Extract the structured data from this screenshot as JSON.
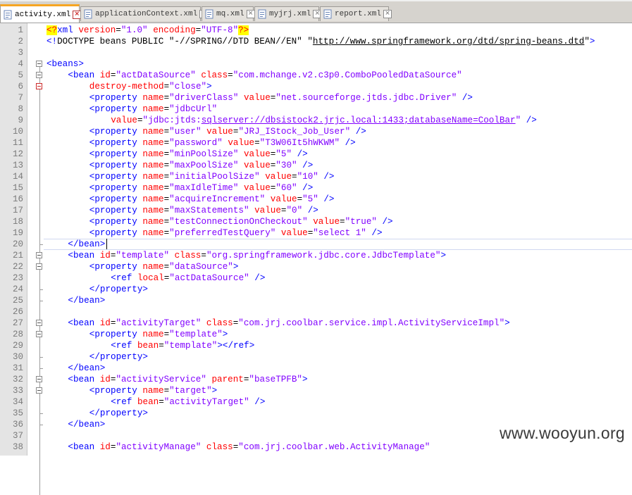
{
  "tabs": [
    {
      "label": "activity.xml",
      "active": true
    },
    {
      "label": "applicationContext.xml",
      "active": false
    },
    {
      "label": "mq.xml",
      "active": false
    },
    {
      "label": "myjrj.xml",
      "active": false
    },
    {
      "label": "report.xml",
      "active": false
    }
  ],
  "editor": {
    "current_line": 20,
    "lines": [
      {
        "n": "1",
        "indent": 0,
        "toks": [
          [
            "pi",
            "<?"
          ],
          [
            "tag",
            "xml "
          ],
          [
            "attr",
            "version"
          ],
          [
            "op",
            "="
          ],
          [
            "val",
            "\"1.0\" "
          ],
          [
            "attr",
            "encoding"
          ],
          [
            "op",
            "="
          ],
          [
            "val",
            "\"UTF-8\""
          ],
          [
            "pi",
            "?>"
          ]
        ]
      },
      {
        "n": "2",
        "indent": 0,
        "toks": [
          [
            "bang",
            "<!"
          ],
          [
            "doctype",
            "DOCTYPE beans PUBLIC \"-//SPRING//DTD BEAN//EN\" \""
          ],
          [
            "url",
            "http://www.springframework.org/dtd/spring-beans.dtd"
          ],
          [
            "doctype",
            "\""
          ],
          [
            "bang",
            ">"
          ]
        ]
      },
      {
        "n": "3",
        "indent": 0,
        "toks": []
      },
      {
        "n": "4",
        "indent": 0,
        "toks": [
          [
            "tag",
            "<beans>"
          ]
        ]
      },
      {
        "n": "5",
        "indent": 4,
        "toks": [
          [
            "tag",
            "<bean "
          ],
          [
            "attr",
            "id"
          ],
          [
            "op",
            "="
          ],
          [
            "val",
            "\"actDataSource\" "
          ],
          [
            "attr",
            "class"
          ],
          [
            "op",
            "="
          ],
          [
            "val",
            "\"com.mchange.v2.c3p0.ComboPooledDataSource\""
          ]
        ]
      },
      {
        "n": "6",
        "indent": 8,
        "toks": [
          [
            "attr",
            "destroy-method"
          ],
          [
            "op",
            "="
          ],
          [
            "val",
            "\"close\""
          ],
          [
            "tag",
            ">"
          ]
        ]
      },
      {
        "n": "7",
        "indent": 8,
        "toks": [
          [
            "tag",
            "<property "
          ],
          [
            "attr",
            "name"
          ],
          [
            "op",
            "="
          ],
          [
            "val",
            "\"driverClass\" "
          ],
          [
            "attr",
            "value"
          ],
          [
            "op",
            "="
          ],
          [
            "val",
            "\"net.sourceforge.jtds.jdbc.Driver\" "
          ],
          [
            "tag",
            "/>"
          ]
        ]
      },
      {
        "n": "8",
        "indent": 8,
        "toks": [
          [
            "tag",
            "<property "
          ],
          [
            "attr",
            "name"
          ],
          [
            "op",
            "="
          ],
          [
            "val",
            "\"jdbcUrl\""
          ]
        ]
      },
      {
        "n": "9",
        "indent": 12,
        "toks": [
          [
            "attr",
            "value"
          ],
          [
            "op",
            "="
          ],
          [
            "val",
            "\"jdbc:jtds:"
          ],
          [
            "valurl",
            "sqlserver://dbsistock2.jrjc.local:1433;databaseName=CoolBar"
          ],
          [
            "val",
            "\" "
          ],
          [
            "tag",
            "/>"
          ]
        ]
      },
      {
        "n": "10",
        "indent": 8,
        "toks": [
          [
            "tag",
            "<property "
          ],
          [
            "attr",
            "name"
          ],
          [
            "op",
            "="
          ],
          [
            "val",
            "\"user\" "
          ],
          [
            "attr",
            "value"
          ],
          [
            "op",
            "="
          ],
          [
            "val",
            "\"JRJ_IStock_Job_User\" "
          ],
          [
            "tag",
            "/>"
          ]
        ]
      },
      {
        "n": "11",
        "indent": 8,
        "toks": [
          [
            "tag",
            "<property "
          ],
          [
            "attr",
            "name"
          ],
          [
            "op",
            "="
          ],
          [
            "val",
            "\"password\" "
          ],
          [
            "attr",
            "value"
          ],
          [
            "op",
            "="
          ],
          [
            "val",
            "\"T3W06It5hWKWM\" "
          ],
          [
            "tag",
            "/>"
          ]
        ]
      },
      {
        "n": "12",
        "indent": 8,
        "toks": [
          [
            "tag",
            "<property "
          ],
          [
            "attr",
            "name"
          ],
          [
            "op",
            "="
          ],
          [
            "val",
            "\"minPoolSize\" "
          ],
          [
            "attr",
            "value"
          ],
          [
            "op",
            "="
          ],
          [
            "val",
            "\"5\" "
          ],
          [
            "tag",
            "/>"
          ]
        ]
      },
      {
        "n": "13",
        "indent": 8,
        "toks": [
          [
            "tag",
            "<property "
          ],
          [
            "attr",
            "name"
          ],
          [
            "op",
            "="
          ],
          [
            "val",
            "\"maxPoolSize\" "
          ],
          [
            "attr",
            "value"
          ],
          [
            "op",
            "="
          ],
          [
            "val",
            "\"30\" "
          ],
          [
            "tag",
            "/>"
          ]
        ]
      },
      {
        "n": "14",
        "indent": 8,
        "toks": [
          [
            "tag",
            "<property "
          ],
          [
            "attr",
            "name"
          ],
          [
            "op",
            "="
          ],
          [
            "val",
            "\"initialPoolSize\" "
          ],
          [
            "attr",
            "value"
          ],
          [
            "op",
            "="
          ],
          [
            "val",
            "\"10\" "
          ],
          [
            "tag",
            "/>"
          ]
        ]
      },
      {
        "n": "15",
        "indent": 8,
        "toks": [
          [
            "tag",
            "<property "
          ],
          [
            "attr",
            "name"
          ],
          [
            "op",
            "="
          ],
          [
            "val",
            "\"maxIdleTime\" "
          ],
          [
            "attr",
            "value"
          ],
          [
            "op",
            "="
          ],
          [
            "val",
            "\"60\" "
          ],
          [
            "tag",
            "/>"
          ]
        ]
      },
      {
        "n": "16",
        "indent": 8,
        "toks": [
          [
            "tag",
            "<property "
          ],
          [
            "attr",
            "name"
          ],
          [
            "op",
            "="
          ],
          [
            "val",
            "\"acquireIncrement\" "
          ],
          [
            "attr",
            "value"
          ],
          [
            "op",
            "="
          ],
          [
            "val",
            "\"5\" "
          ],
          [
            "tag",
            "/>"
          ]
        ]
      },
      {
        "n": "17",
        "indent": 8,
        "toks": [
          [
            "tag",
            "<property "
          ],
          [
            "attr",
            "name"
          ],
          [
            "op",
            "="
          ],
          [
            "val",
            "\"maxStatements\" "
          ],
          [
            "attr",
            "value"
          ],
          [
            "op",
            "="
          ],
          [
            "val",
            "\"0\" "
          ],
          [
            "tag",
            "/>"
          ]
        ]
      },
      {
        "n": "18",
        "indent": 8,
        "toks": [
          [
            "tag",
            "<property "
          ],
          [
            "attr",
            "name"
          ],
          [
            "op",
            "="
          ],
          [
            "val",
            "\"testConnectionOnCheckout\" "
          ],
          [
            "attr",
            "value"
          ],
          [
            "op",
            "="
          ],
          [
            "val",
            "\"true\" "
          ],
          [
            "tag",
            "/>"
          ]
        ]
      },
      {
        "n": "19",
        "indent": 8,
        "toks": [
          [
            "tag",
            "<property "
          ],
          [
            "attr",
            "name"
          ],
          [
            "op",
            "="
          ],
          [
            "val",
            "\"preferredTestQuery\" "
          ],
          [
            "attr",
            "value"
          ],
          [
            "op",
            "="
          ],
          [
            "val",
            "\"select 1\" "
          ],
          [
            "tag",
            "/>"
          ]
        ]
      },
      {
        "n": "20",
        "indent": 4,
        "toks": [
          [
            "tag",
            "</bean>"
          ]
        ]
      },
      {
        "n": "21",
        "indent": 4,
        "toks": [
          [
            "tag",
            "<bean "
          ],
          [
            "attr",
            "id"
          ],
          [
            "op",
            "="
          ],
          [
            "val",
            "\"template\" "
          ],
          [
            "attr",
            "class"
          ],
          [
            "op",
            "="
          ],
          [
            "val",
            "\"org.springframework.jdbc.core.JdbcTemplate\""
          ],
          [
            "tag",
            ">"
          ]
        ]
      },
      {
        "n": "22",
        "indent": 8,
        "toks": [
          [
            "tag",
            "<property "
          ],
          [
            "attr",
            "name"
          ],
          [
            "op",
            "="
          ],
          [
            "val",
            "\"dataSource\""
          ],
          [
            "tag",
            ">"
          ]
        ]
      },
      {
        "n": "23",
        "indent": 12,
        "toks": [
          [
            "tag",
            "<ref "
          ],
          [
            "attr",
            "local"
          ],
          [
            "op",
            "="
          ],
          [
            "val",
            "\"actDataSource\" "
          ],
          [
            "tag",
            "/>"
          ]
        ]
      },
      {
        "n": "24",
        "indent": 8,
        "toks": [
          [
            "tag",
            "</property>"
          ]
        ]
      },
      {
        "n": "25",
        "indent": 4,
        "toks": [
          [
            "tag",
            "</bean>"
          ]
        ]
      },
      {
        "n": "26",
        "indent": 0,
        "toks": []
      },
      {
        "n": "27",
        "indent": 4,
        "toks": [
          [
            "tag",
            "<bean "
          ],
          [
            "attr",
            "id"
          ],
          [
            "op",
            "="
          ],
          [
            "val",
            "\"activityTarget\" "
          ],
          [
            "attr",
            "class"
          ],
          [
            "op",
            "="
          ],
          [
            "val",
            "\"com.jrj.coolbar.service.impl.ActivityServiceImpl\""
          ],
          [
            "tag",
            ">"
          ]
        ]
      },
      {
        "n": "28",
        "indent": 8,
        "toks": [
          [
            "tag",
            "<property "
          ],
          [
            "attr",
            "name"
          ],
          [
            "op",
            "="
          ],
          [
            "val",
            "\"template\""
          ],
          [
            "tag",
            ">"
          ]
        ]
      },
      {
        "n": "29",
        "indent": 12,
        "toks": [
          [
            "tag",
            "<ref "
          ],
          [
            "attr",
            "bean"
          ],
          [
            "op",
            "="
          ],
          [
            "val",
            "\"template\""
          ],
          [
            "tag",
            "></ref>"
          ]
        ]
      },
      {
        "n": "30",
        "indent": 8,
        "toks": [
          [
            "tag",
            "</property>"
          ]
        ]
      },
      {
        "n": "31",
        "indent": 4,
        "toks": [
          [
            "tag",
            "</bean>"
          ]
        ]
      },
      {
        "n": "32",
        "indent": 4,
        "toks": [
          [
            "tag",
            "<bean "
          ],
          [
            "attr",
            "id"
          ],
          [
            "op",
            "="
          ],
          [
            "val",
            "\"activityService\" "
          ],
          [
            "attr",
            "parent"
          ],
          [
            "op",
            "="
          ],
          [
            "val",
            "\"baseTPFB\""
          ],
          [
            "tag",
            ">"
          ]
        ]
      },
      {
        "n": "33",
        "indent": 8,
        "toks": [
          [
            "tag",
            "<property "
          ],
          [
            "attr",
            "name"
          ],
          [
            "op",
            "="
          ],
          [
            "val",
            "\"target\""
          ],
          [
            "tag",
            ">"
          ]
        ]
      },
      {
        "n": "34",
        "indent": 12,
        "toks": [
          [
            "tag",
            "<ref "
          ],
          [
            "attr",
            "bean"
          ],
          [
            "op",
            "="
          ],
          [
            "val",
            "\"activityTarget\" "
          ],
          [
            "tag",
            "/>"
          ]
        ]
      },
      {
        "n": "35",
        "indent": 8,
        "toks": [
          [
            "tag",
            "</property>"
          ]
        ]
      },
      {
        "n": "36",
        "indent": 4,
        "toks": [
          [
            "tag",
            "</bean>"
          ]
        ]
      },
      {
        "n": "37",
        "indent": 0,
        "toks": []
      },
      {
        "n": "38",
        "indent": 4,
        "toks": [
          [
            "tag",
            "<bean "
          ],
          [
            "attr",
            "id"
          ],
          [
            "op",
            "="
          ],
          [
            "val",
            "\"activityManage\" "
          ],
          [
            "attr",
            "class"
          ],
          [
            "op",
            "="
          ],
          [
            "val",
            "\"com.jrj.coolbar.web.ActivityManage\""
          ]
        ]
      }
    ]
  },
  "watermark": "www.wooyun.org",
  "colors": {
    "tag": "#0000ff",
    "attr": "#ff0000",
    "value": "#8000ff",
    "pi_highlight": "#ffff00",
    "active_tab_accent": "#f6a623"
  }
}
